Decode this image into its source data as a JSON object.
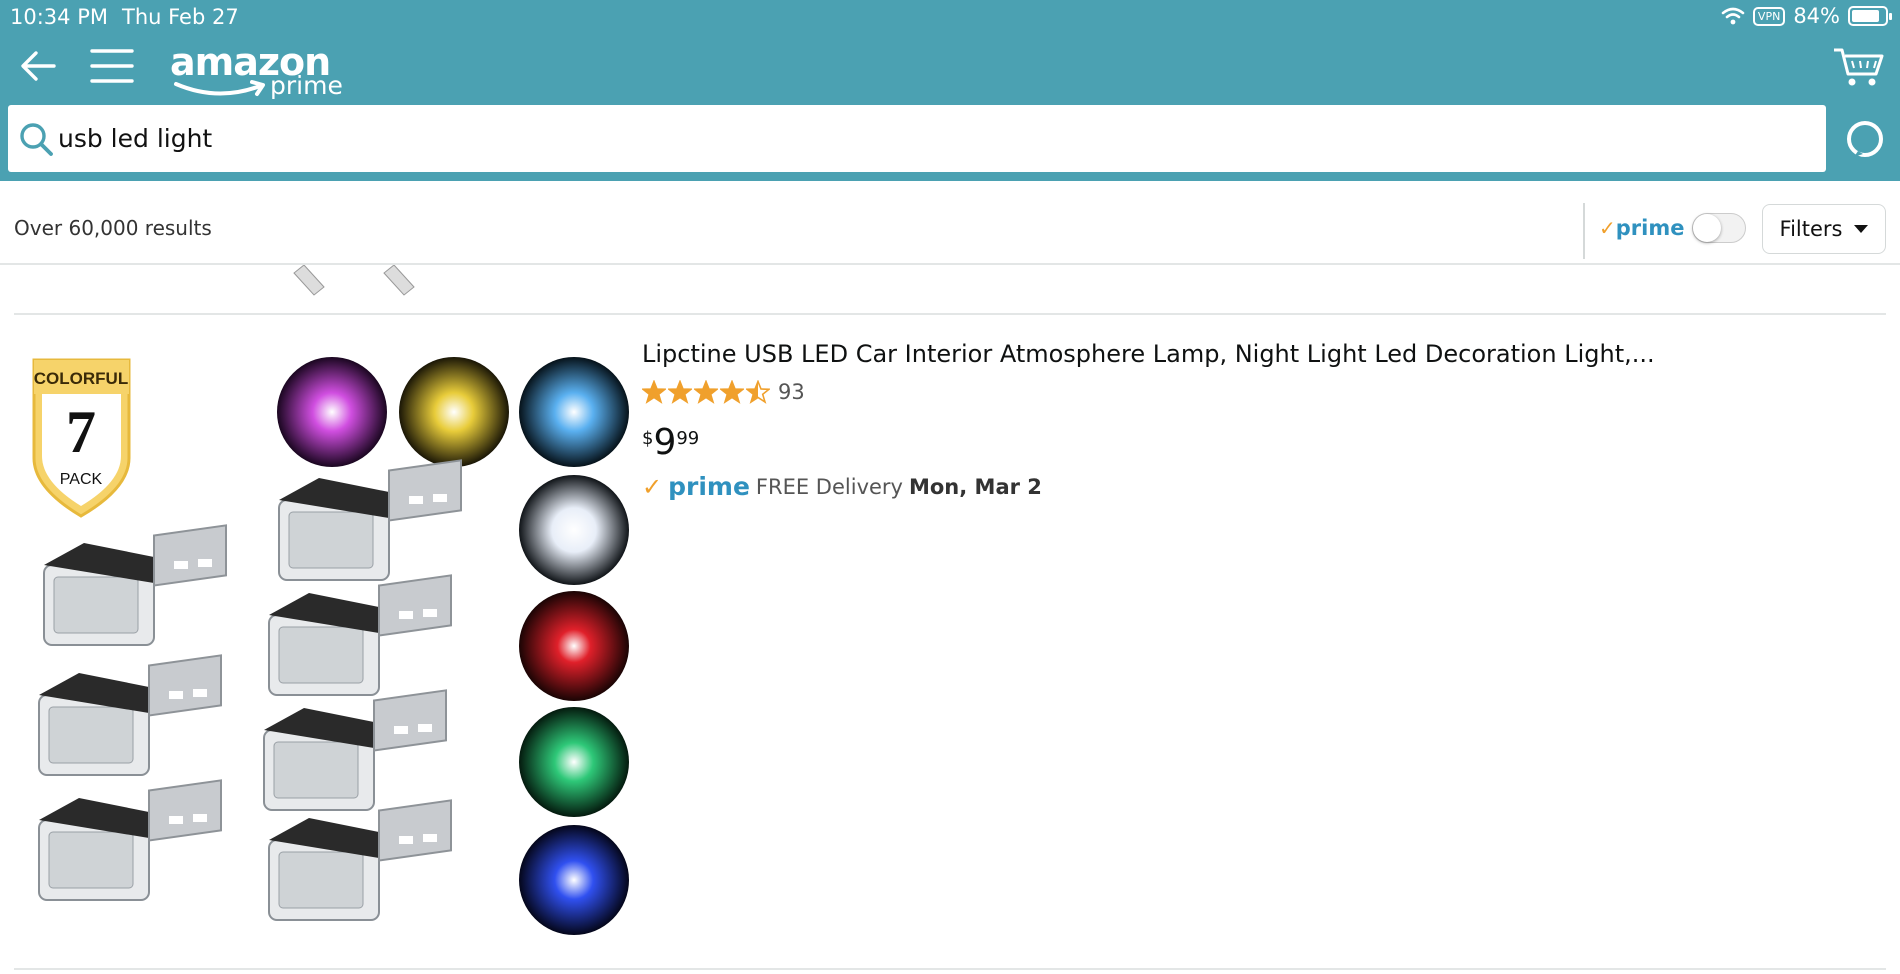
{
  "status_bar": {
    "time": "10:34 PM",
    "date": "Thu Feb 27",
    "vpn": "VPN",
    "battery": "84%",
    "battery_level": 0.84
  },
  "header": {
    "logo_main": "amazon",
    "logo_sub": "prime",
    "search_value": "usb led light",
    "icons": [
      "back-arrow-icon",
      "hamburger-menu-icon",
      "cart-icon",
      "search-icon",
      "alexa-icon"
    ],
    "background_color": "#4ba1b2"
  },
  "results": {
    "count_text": "Over 60,000 results",
    "prime_check": "✓",
    "prime_label": "prime",
    "prime_toggle_on": false,
    "filters_label": "Filters"
  },
  "product": {
    "title": "Lipctine USB LED Car Interior Atmosphere Lamp, Night Light Led Decoration Light,...",
    "rating": 4.5,
    "rating_count": "93",
    "price_symbol": "$",
    "price_whole": "9",
    "price_fraction": "99",
    "delivery_check": "✓",
    "delivery_prime": "prime",
    "delivery_text": "FREE Delivery",
    "delivery_date": "Mon, Mar 2",
    "image": {
      "badge_top": "COLORFUL",
      "badge_number": "7",
      "badge_bottom": "PACK",
      "light_colors": [
        "#d04ee0",
        "#e8cc3a",
        "#5ab0f0",
        "#e8eef8",
        "#e0202a",
        "#2ec878",
        "#3050f0"
      ]
    }
  },
  "colors": {
    "prime_blue": "#2f91bf",
    "prime_check_orange": "#f0a02c",
    "star_orange": "#f0a02c"
  }
}
